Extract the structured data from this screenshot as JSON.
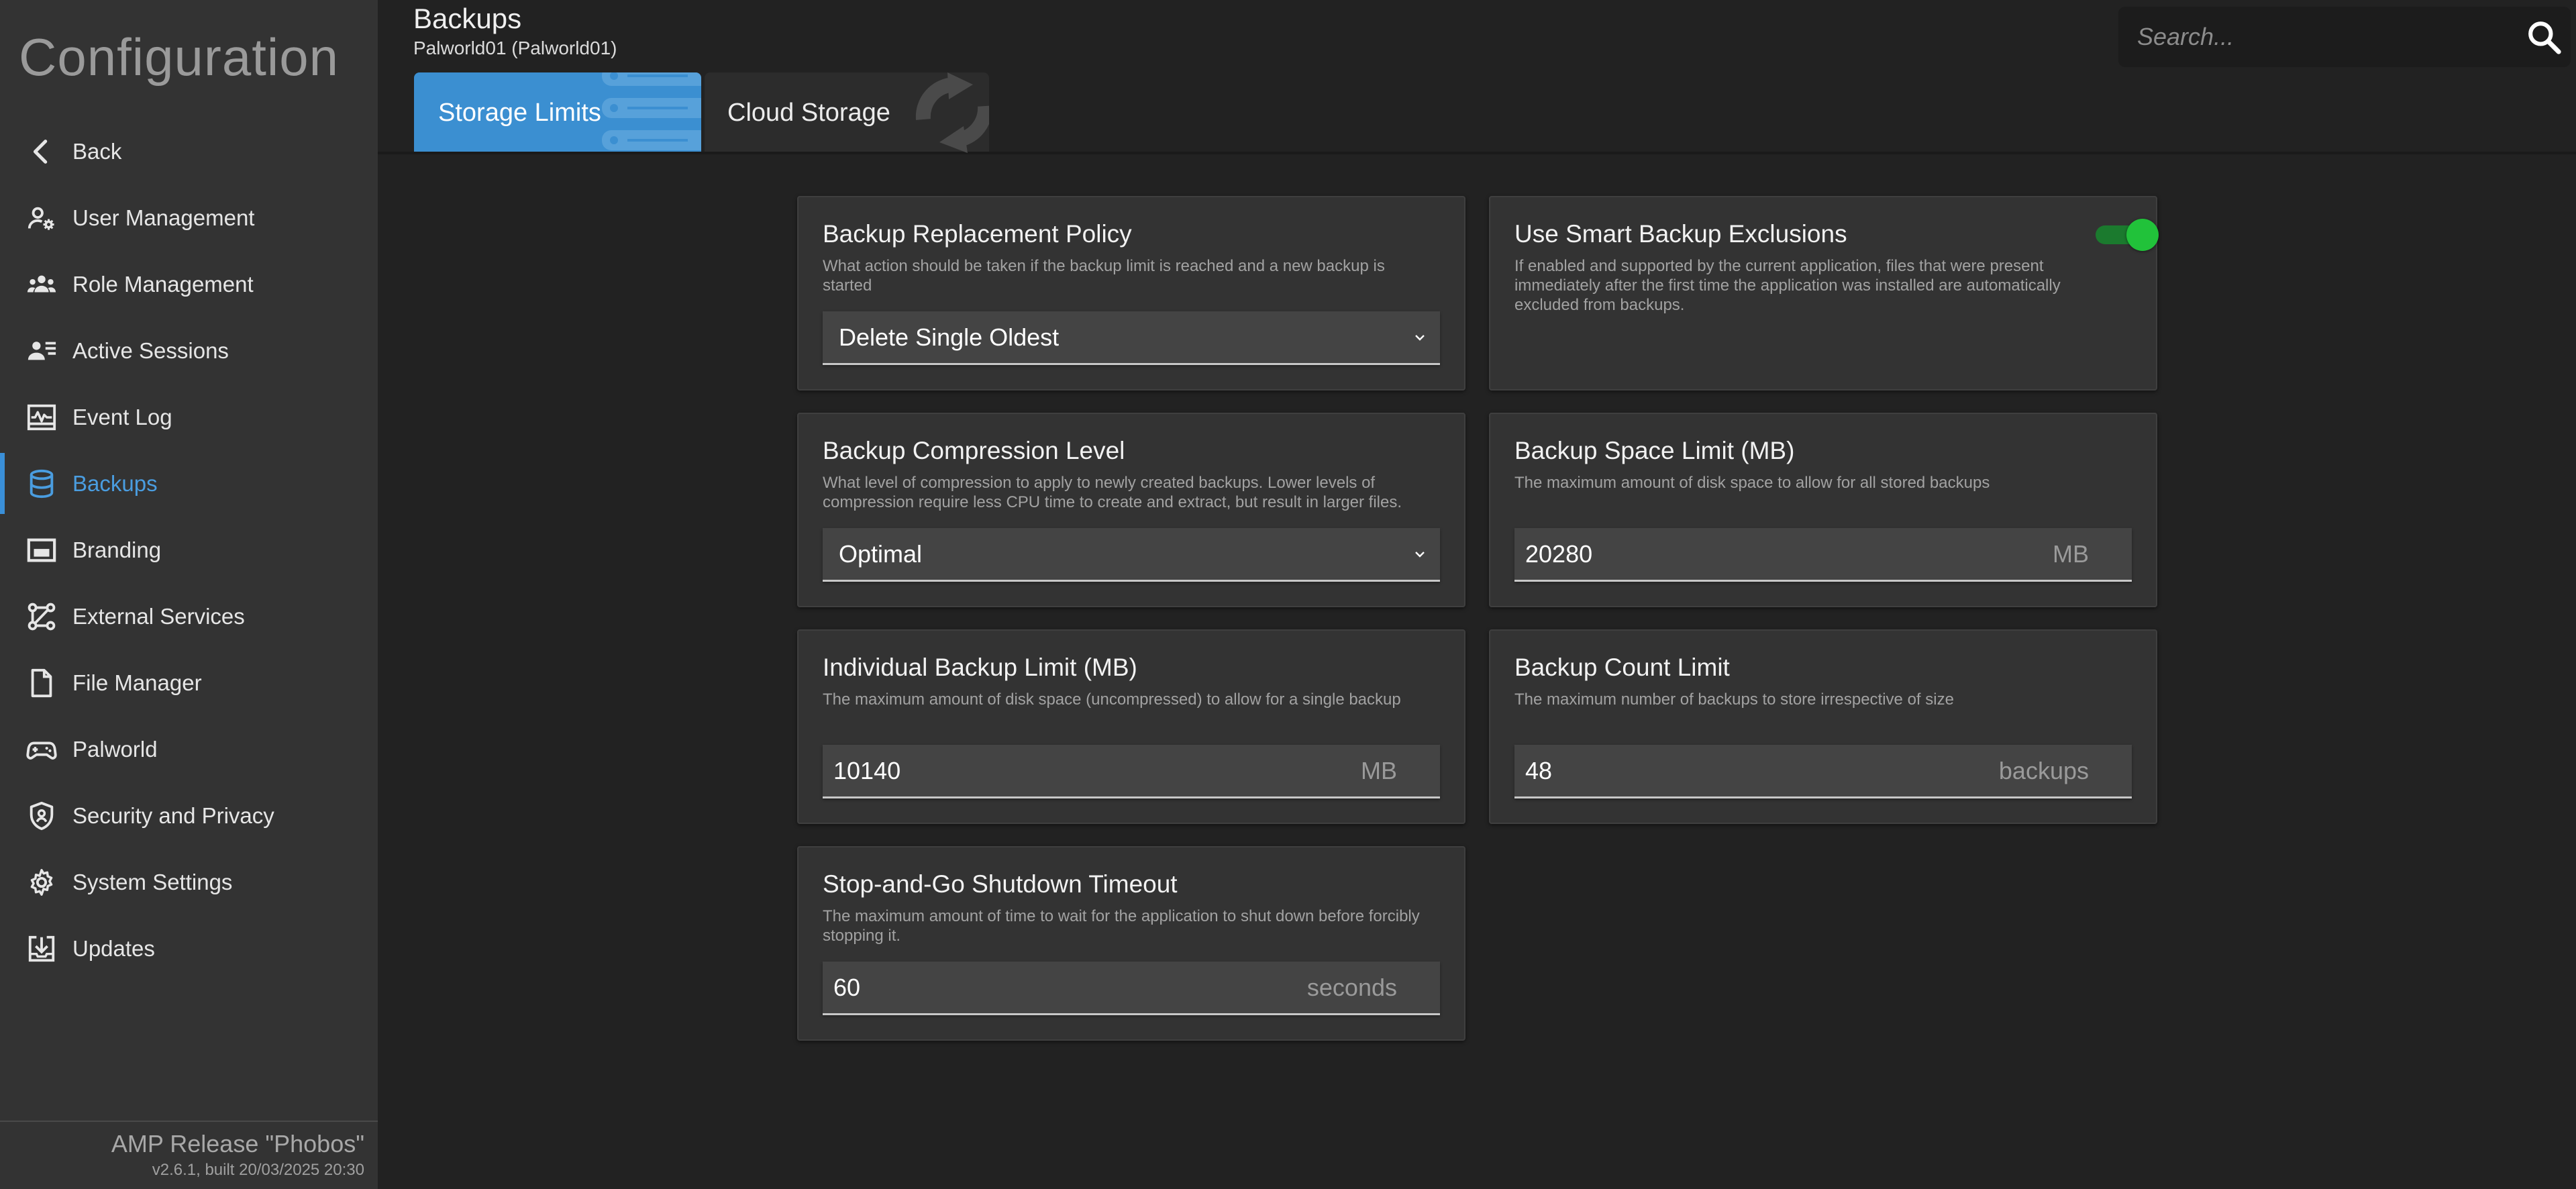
{
  "sidebar": {
    "title": "Configuration",
    "items": [
      {
        "label": "Back",
        "icon": "chevron-left-icon"
      },
      {
        "label": "User Management",
        "icon": "user-gear-icon"
      },
      {
        "label": "Role Management",
        "icon": "users-icon"
      },
      {
        "label": "Active Sessions",
        "icon": "user-list-icon"
      },
      {
        "label": "Event Log",
        "icon": "monitor-heartbeat-icon"
      },
      {
        "label": "Backups",
        "icon": "database-icon",
        "active": true
      },
      {
        "label": "Branding",
        "icon": "picture-in-picture-icon"
      },
      {
        "label": "External Services",
        "icon": "network-nodes-icon"
      },
      {
        "label": "File Manager",
        "icon": "file-icon"
      },
      {
        "label": "Palworld",
        "icon": "gamepad-icon"
      },
      {
        "label": "Security and Privacy",
        "icon": "shield-lock-icon"
      },
      {
        "label": "System Settings",
        "icon": "gear-icon"
      },
      {
        "label": "Updates",
        "icon": "download-tray-icon"
      }
    ],
    "footer": {
      "release": "AMP Release \"Phobos\"",
      "build": "v2.6.1, built 20/03/2025 20:30"
    }
  },
  "header": {
    "title": "Backups",
    "subtitle": "Palworld01 (Palworld01)"
  },
  "search": {
    "placeholder": "Search..."
  },
  "tabs": [
    {
      "label": "Storage Limits",
      "active": true
    },
    {
      "label": "Cloud Storage",
      "active": false
    }
  ],
  "cards": {
    "replacement_policy": {
      "title": "Backup Replacement Policy",
      "description": "What action should be taken if the backup limit is reached and a new backup is started",
      "value": "Delete Single Oldest"
    },
    "smart_exclusions": {
      "title": "Use Smart Backup Exclusions",
      "description": "If enabled and supported by the current application, files that were present immediately after the first time the application was installed are automatically excluded from backups.",
      "enabled": true
    },
    "compression": {
      "title": "Backup Compression Level",
      "description": "What level of compression to apply to newly created backups. Lower levels of compression require less CPU time to create and extract, but result in larger files.",
      "value": "Optimal"
    },
    "space_limit": {
      "title": "Backup Space Limit (MB)",
      "description": "The maximum amount of disk space to allow for all stored backups",
      "value": "20280",
      "unit": "MB"
    },
    "individual_limit": {
      "title": "Individual Backup Limit (MB)",
      "description": "The maximum amount of disk space (uncompressed) to allow for a single backup",
      "value": "10140",
      "unit": "MB"
    },
    "count_limit": {
      "title": "Backup Count Limit",
      "description": "The maximum number of backups to store irrespective of size",
      "value": "48",
      "unit": "backups"
    },
    "shutdown_timeout": {
      "title": "Stop-and-Go Shutdown Timeout",
      "description": "The maximum amount of time to wait for the application to shut down before forcibly stopping it.",
      "value": "60",
      "unit": "seconds"
    }
  },
  "colors": {
    "accent": "#3b8fd1",
    "toggle_on": "#21c23a"
  }
}
